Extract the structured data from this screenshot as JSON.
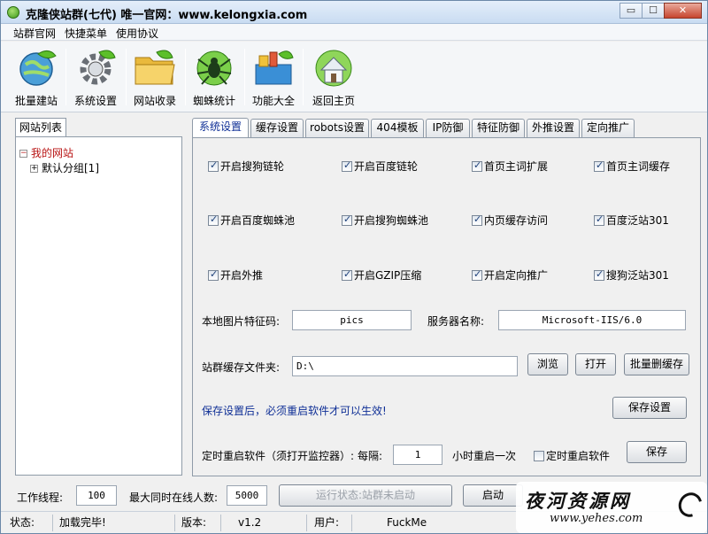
{
  "window": {
    "title": "克隆侠站群(七代)   唯一官网：www.kelongxia.com",
    "controls": {
      "minimize": "▭",
      "maximize": "☐",
      "close": "✕"
    }
  },
  "menu": [
    "站群官网",
    "快捷菜单",
    "使用协议"
  ],
  "toolbar": [
    {
      "label": "批量建站",
      "icon": "globe-leaf-icon"
    },
    {
      "label": "系统设置",
      "icon": "gear-leaf-icon"
    },
    {
      "label": "网站收录",
      "icon": "folder-leaf-icon"
    },
    {
      "label": "蜘蛛统计",
      "icon": "spider-icon"
    },
    {
      "label": "功能大全",
      "icon": "toolbox-icon"
    },
    {
      "label": "返回主页",
      "icon": "home-icon"
    }
  ],
  "left": {
    "tab": "网站列表",
    "tree": {
      "root": "我的网站",
      "child": "默认分组[1]"
    }
  },
  "tabs": [
    "系统设置",
    "缓存设置",
    "robots设置",
    "404模板",
    "IP防御",
    "特征防御",
    "外推设置",
    "定向推广"
  ],
  "active_tab": 0,
  "checkboxes": [
    {
      "label": "开启搜狗链轮",
      "checked": true
    },
    {
      "label": "开启百度链轮",
      "checked": true
    },
    {
      "label": "首页主词扩展",
      "checked": true
    },
    {
      "label": "首页主词缓存",
      "checked": true
    },
    {
      "label": "开启百度蜘蛛池",
      "checked": true
    },
    {
      "label": "开启搜狗蜘蛛池",
      "checked": true
    },
    {
      "label": "内页缓存访问",
      "checked": true
    },
    {
      "label": "百度泛站301",
      "checked": true
    },
    {
      "label": "开启外推",
      "checked": true
    },
    {
      "label": "开启GZIP压缩",
      "checked": true
    },
    {
      "label": "开启定向推广",
      "checked": true
    },
    {
      "label": "搜狗泛站301",
      "checked": true
    }
  ],
  "settings": {
    "image_code_label": "本地图片特征码:",
    "image_code_value": "pics",
    "server_name_label": "服务器名称:",
    "server_name_value": "Microsoft-IIS/6.0",
    "cache_folder_label": "站群缓存文件夹:",
    "cache_folder_value": "D:\\",
    "browse_btn": "浏览",
    "open_btn": "打开",
    "batch_delete_btn": "批量删缓存",
    "restart_note": "保存设置后，必须重启软件才可以生效!",
    "save_settings_btn": "保存设置",
    "timed_restart_label": "定时重启软件（须打开监控器）:",
    "every_label": "每隔:",
    "every_value": "1",
    "hours_label": "小时重启一次",
    "timed_restart_checkbox": "定时重启软件",
    "timed_restart_checked": false,
    "save_btn": "保存"
  },
  "bottom": {
    "threads_label": "工作线程:",
    "threads_value": "100",
    "max_online_label": "最大同时在线人数:",
    "max_online_value": "5000",
    "run_status": "运行状态:站群未启动",
    "start_btn": "启动"
  },
  "status": {
    "state_label": "状态:",
    "state_value": "加载完毕!",
    "version_label": "版本:",
    "version_value": "v1.2",
    "user_label": "用户:",
    "user_value": "FuckMe"
  },
  "watermark": {
    "main": "夜河资源网",
    "sub": "www.yehes.com"
  }
}
